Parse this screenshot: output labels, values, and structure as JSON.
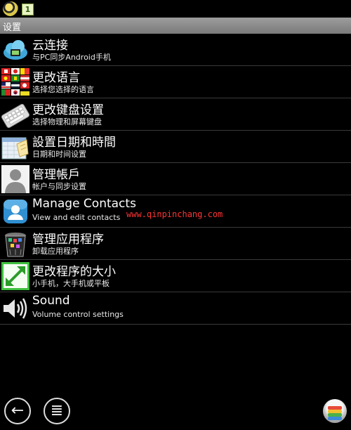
{
  "statusbar": {
    "app_badge": "1"
  },
  "header": {
    "title": "设置"
  },
  "items": [
    {
      "title": "云连接",
      "subtitle": "与PC同步Android手机",
      "icon": "cloud-icon"
    },
    {
      "title": "更改语言",
      "subtitle": "选择您选择的语言",
      "icon": "flags-icon"
    },
    {
      "title": "更改键盘设置",
      "subtitle": "选择物理和屏幕键盘",
      "icon": "keyboard-icon"
    },
    {
      "title": "設置日期和時間",
      "subtitle": "日期和时间设置",
      "icon": "calendar-icon"
    },
    {
      "title": "管理帳戶",
      "subtitle": "帐户与同步设置",
      "icon": "account-icon"
    },
    {
      "title": "Manage Contacts",
      "subtitle": "View and edit contacts",
      "icon": "contacts-icon"
    },
    {
      "title": "管理应用程序",
      "subtitle": "卸载应用程序",
      "icon": "trash-icon"
    },
    {
      "title": "更改程序的大小",
      "subtitle": "小手机，大手机或平板",
      "icon": "resize-icon"
    },
    {
      "title": "Sound",
      "subtitle": "Volume control settings",
      "icon": "speaker-icon"
    }
  ],
  "watermark": "www.qinpinchang.com",
  "navbar": {
    "back_glyph": "←",
    "menu_glyph": "≣"
  },
  "colors": {
    "title_bar": "#8a8a8a",
    "divider": "#3a3a3a",
    "watermark": "#ff3333",
    "background": "#000000"
  }
}
